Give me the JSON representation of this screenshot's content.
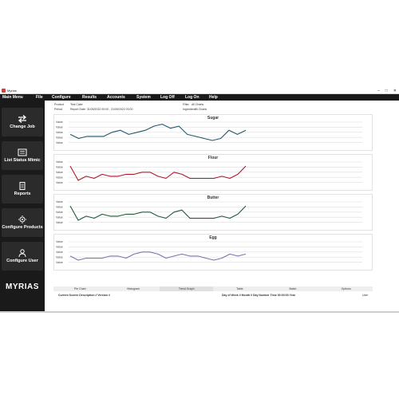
{
  "window": {
    "title": "Myrias",
    "controls": [
      "–",
      "□",
      "✕"
    ]
  },
  "menu": {
    "main": "Main Menu",
    "items": [
      "File",
      "Configure",
      "Results",
      "Accounts",
      "System",
      "Log Off",
      "Log On",
      "Help"
    ]
  },
  "sidebar": {
    "buttons": [
      {
        "label": "Change Job",
        "icon": "swap-arrows-icon"
      },
      {
        "label": "List Status Mimic",
        "icon": "list-status-icon"
      },
      {
        "label": "Reports",
        "icon": "document-icon"
      },
      {
        "label": "Configure Products",
        "icon": "product-gears-icon"
      },
      {
        "label": "Configure User",
        "icon": "user-icon"
      }
    ],
    "logo": "MYRIAS"
  },
  "info": {
    "product_label": "Product",
    "product_value": "Test Cake",
    "period_label": "Period",
    "period_value": "Report Date: 31/05/2022 00:00 - 31/05/2022 00:00",
    "filter_label": "Filter",
    "filter_value": "All Charts",
    "ingredient_label": "Ingredient",
    "ingredient_value": "All Charts"
  },
  "chart_data": [
    {
      "type": "line",
      "title": "Sugar",
      "color": "#1f5a6e",
      "yticks": [
        "Value",
        "Value",
        "Value",
        "Value",
        "Value"
      ],
      "values": [
        4,
        2,
        3,
        3,
        3,
        5,
        6,
        4,
        5,
        6,
        8,
        9,
        7,
        8,
        4,
        3,
        2,
        1,
        2,
        6,
        4,
        6
      ]
    },
    {
      "type": "line",
      "title": "Flour",
      "color": "#b0182a",
      "yticks": [
        "Value",
        "Value",
        "Value",
        "Value",
        "Value"
      ],
      "values": [
        8,
        1,
        3,
        2,
        4,
        3,
        3,
        4,
        4,
        5,
        5,
        3,
        2,
        5,
        4,
        2,
        2,
        2,
        2,
        3,
        2,
        4,
        8
      ]
    },
    {
      "type": "line",
      "title": "Butter",
      "color": "#1f5a38",
      "yticks": [
        "Value",
        "Value",
        "Value",
        "Value",
        "Value"
      ],
      "values": [
        8,
        1,
        3,
        2,
        4,
        3,
        3,
        4,
        4,
        5,
        5,
        3,
        2,
        5,
        6,
        2,
        2,
        2,
        2,
        3,
        2,
        4,
        8
      ]
    },
    {
      "type": "line",
      "title": "Egg",
      "color": "#7a74a8",
      "yticks": [
        "Value",
        "Value",
        "Value",
        "Value",
        "Value"
      ],
      "values": [
        3,
        1,
        2,
        2,
        2,
        3,
        3,
        2,
        4,
        5,
        5,
        4,
        2,
        3,
        4,
        3,
        3,
        2,
        1,
        2,
        4,
        3,
        4
      ]
    }
  ],
  "tabs": [
    "Pie Chart",
    "Histogram",
    "Trend Graph",
    "Table",
    "Batch",
    "Options"
  ],
  "active_tab": 2,
  "status": {
    "left": "Current Screen Description // Version #",
    "center": "Day of Week // Month // Day Number Time 00:00:00 Year",
    "right": "User"
  }
}
